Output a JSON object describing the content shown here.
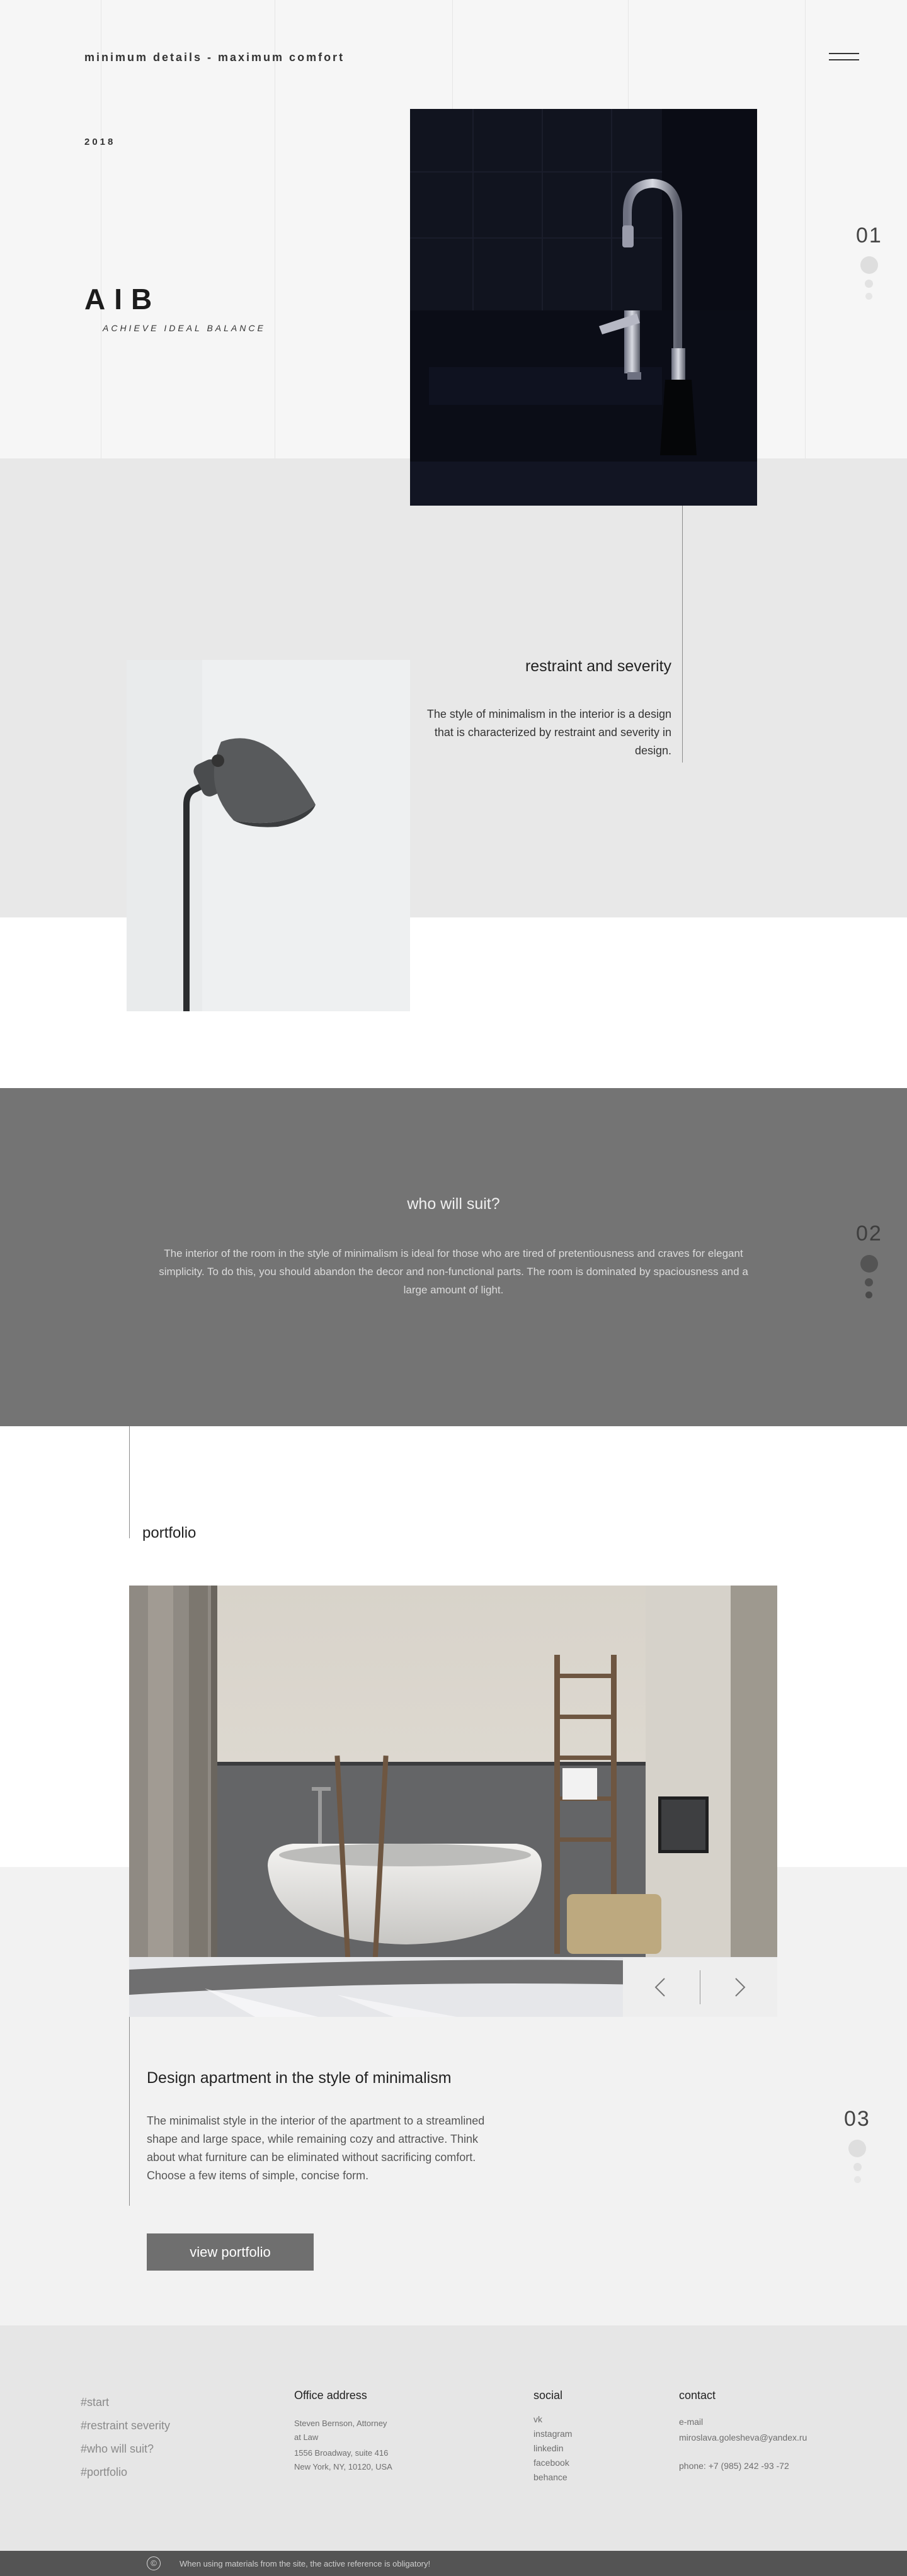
{
  "hero": {
    "tagline": "minimum details - maximum comfort",
    "year": "2018",
    "logo": "AIB",
    "slogan": "ACHIEVE IDEAL BALANCE",
    "section_number": "01"
  },
  "restraint": {
    "title": "restraint and severity",
    "text": "The style of minimalism in the interior is a design that is characterized by restraint and severity in design."
  },
  "who": {
    "title": "who will suit?",
    "text": "The interior of the room in the style of minimalism is ideal for those who are tired of pretentiousness and craves for elegant simplicity. To do this, you should abandon the decor and non-functional parts. The room is dominated by spaciousness and a large amount of light.",
    "section_number": "02"
  },
  "portfolio": {
    "heading": "portfolio",
    "title": "Design apartment in the style of minimalism",
    "text": "The minimalist style in the interior of the apartment to a streamlined shape and large space, while remaining cozy and attractive. Think about what furniture can be eliminated without sacrificing comfort. Choose a few items of simple, concise form.",
    "button_label": "view portfolio",
    "section_number": "03"
  },
  "footer": {
    "nav": [
      "#start",
      "#restraint severity",
      "#who will suit?",
      "#portfolio"
    ],
    "office_heading": "Office address",
    "office_lines": [
      "Steven Bernson, Attorney",
      "at Law",
      "1556 Broadway, suite 416",
      "New York, NY, 10120, USA"
    ],
    "social_heading": "social",
    "social_links": [
      "vk",
      "instagram",
      "linkedin",
      "facebook",
      "behance"
    ],
    "contact_heading": "contact",
    "email_label": "e-mail",
    "email": "miroslava.golesheva@yandex.ru",
    "phone": "phone: +7 (985) 242 -93 -72",
    "copyright_symbol": "©",
    "copyright_text": "When using materials from the site, the active reference is obligatory!"
  }
}
